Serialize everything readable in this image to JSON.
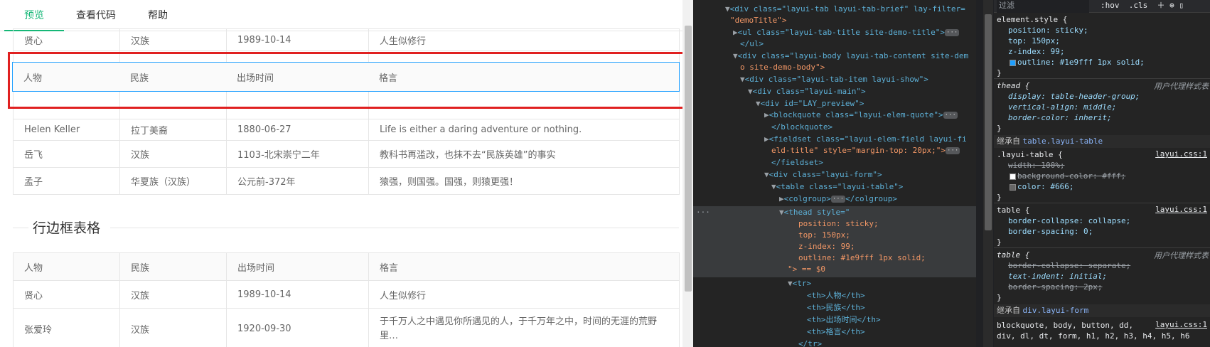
{
  "tabs": [
    "预览",
    "查看代码",
    "帮助"
  ],
  "table1": {
    "rows": [
      [
        "贤心",
        "汉族",
        "1989-10-14",
        "人生似修行"
      ],
      [
        "",
        "",
        "",
        ""
      ],
      [
        "Helen Keller",
        "拉丁美裔",
        "1880-06-27",
        "Life is either a daring adventure or nothing."
      ],
      [
        "岳飞",
        "汉族",
        "1103-北宋崇宁二年",
        "教科书再滥改，也抹不去“民族英雄”的事实"
      ],
      [
        "孟子",
        "华夏族（汉族）",
        "公元前-372年",
        "猿强，则国强。国强，则猿更强！"
      ]
    ]
  },
  "sticky_header": [
    "人物",
    "民族",
    "出场时间",
    "格言"
  ],
  "legend": "行边框表格",
  "table2": {
    "header": [
      "人物",
      "民族",
      "出场时间",
      "格言"
    ],
    "rows": [
      [
        "贤心",
        "汉族",
        "1989-10-14",
        "人生似修行"
      ],
      [
        "张爱玲",
        "汉族",
        "1920-09-30",
        "于千万人之中遇见你所遇见的人，于千万年之中，时间的无涯的荒野里…"
      ]
    ]
  },
  "devtools": {
    "filter_placeholder": "过滤",
    "hov": ":hov",
    "cls": ".cls",
    "dom": {
      "l1a": "<div class=\"layui-tab layui-tab-brief\" lay-filter=",
      "l1b": "\"demoTitle\">",
      "l2": "<ul class=\"layui-tab-title site-demo-title\">",
      "l3": "</ul>",
      "l4a": "<div class=\"layui-body layui-tab-content site-dem",
      "l4b": "o site-demo-body\">",
      "l5": "<div class=\"layui-tab-item layui-show\">",
      "l6": "<div class=\"layui-main\">",
      "l7": "<div id=\"LAY_preview\">",
      "l8": "<blockquote class=\"layui-elem-quote\">",
      "l9": "</blockquote>",
      "l10a": "<fieldset class=\"layui-elem-field layui-fi",
      "l10b": "eld-title\" style=\"margin-top: 20px;\">",
      "l11": "</fieldset>",
      "l12": "<div class=\"layui-form\">",
      "l13": "<table class=\"layui-table\">",
      "l14": "<colgroup>",
      "l14b": "</colgroup>",
      "l15": "<thead style=\"",
      "l16": "position: sticky;",
      "l17": "top: 150px;",
      "l18": "z-index: 99;",
      "l19": "outline: #1e9fff 1px solid;",
      "l20": "\"> == $0",
      "l21": "<tr>",
      "th1": "<th>人物</th>",
      "th2": "<th>民族</th>",
      "th3": "<th>出场时间</th>",
      "th4": "<th>格言</th>",
      "l26": "</tr>"
    },
    "styles": {
      "element_style": "element.style {",
      "es_props": [
        "position: sticky;",
        "top: 150px;",
        "z-index: 99;",
        "outline: #1e9fff 1px solid;"
      ],
      "thead_rule": "thead {",
      "ua": "用户代理样式表",
      "thead_props": [
        "display: table-header-group;",
        "vertical-align: middle;",
        "border-color: inherit;"
      ],
      "inherited1": "继承自",
      "inherited1_link": "table.layui-table",
      "layui_table_rule": ".layui-table {",
      "src": "layui.css:1",
      "lt_props": [
        "width: 100%;",
        "background-color: #fff;",
        "color: #666;"
      ],
      "table_rule": "table {",
      "t_props": [
        "border-collapse: collapse;",
        "border-spacing: 0;"
      ],
      "table_ua_rule": "table {",
      "tua_props": [
        "border-collapse: separate;",
        "text-indent: initial;",
        "border-spacing: 2px;"
      ],
      "inherited2": "继承自",
      "inherited2_link": "div.layui-form",
      "last_line": "blockquote, body, button, dd,",
      "last_line2": "div, dl, dt, form, h1, h2, h3, h4, h5, h6"
    }
  },
  "colors": {
    "accent": "#16b777",
    "outline": "#1e9fff",
    "highlight": "#e02020"
  }
}
